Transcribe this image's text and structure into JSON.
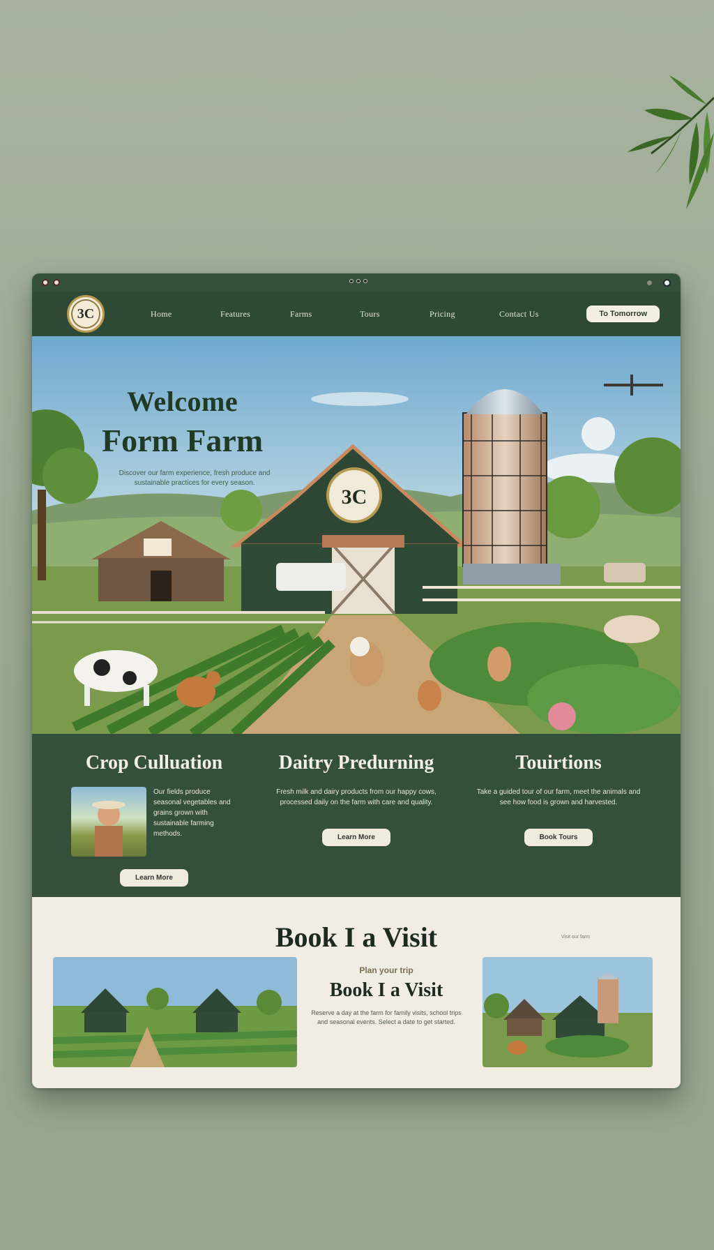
{
  "nav": {
    "logo_text": "3C",
    "links": [
      "Home",
      "Features",
      "Farms",
      "Tours",
      "Pricing",
      "Contact Us"
    ],
    "cta_label": "To Tomorrow"
  },
  "hero": {
    "title_line1": "Welcome",
    "title_line2": "Form Farm",
    "subtitle": "Discover our farm experience, fresh produce and sustainable practices for every season.",
    "barn_sign": "3C"
  },
  "services": [
    {
      "title": "Crop Culluation",
      "text": "Our fields produce seasonal vegetables and grains grown with sustainable farming methods.",
      "button": "Learn More"
    },
    {
      "title": "Daitry Predurning",
      "text": "Fresh milk and dairy products from our happy cows, processed daily on the farm with care and quality.",
      "button": "Learn More"
    },
    {
      "title": "Touirtions",
      "text": "Take a guided tour of our farm, meet the animals and see how food is grown and harvested.",
      "button": "Book Tours"
    }
  ],
  "booking": {
    "heading": "Book I a Visit",
    "kicker": "Plan your trip",
    "subheading": "Book I a Visit",
    "text": "Reserve a day at the farm for family visits, school trips and seasonal events. Select a date to get started.",
    "tiny_right": "Visit our farm"
  },
  "colors": {
    "brand_green": "#2e4a34",
    "panel_green": "#34503a",
    "cream": "#f1ede4",
    "background": "#9aa891"
  },
  "icons": [
    "close-dot-icon",
    "minimize-dot-icon",
    "maximize-dot-icon",
    "leaf-branch-icon"
  ]
}
